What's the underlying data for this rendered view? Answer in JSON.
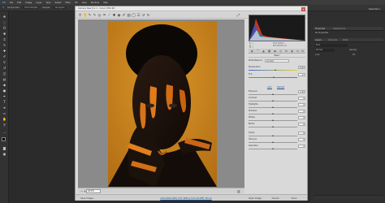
{
  "menubar": [
    "PS",
    "File",
    "Edit",
    "Image",
    "Layer",
    "Type",
    "Select",
    "Filter",
    "3D",
    "View",
    "Window",
    "Help"
  ],
  "options_bar": {
    "label": "Sample Size:",
    "value": "Point Sample",
    "sample_label": "Sample:",
    "sample_value": "All Layers"
  },
  "dialog": {
    "title": "Camera Raw 9.1.1  -  Canon EOS 6D",
    "preview_zoom": "26.8%",
    "bottom": {
      "save_image": "Save Image...",
      "workflow_link": "Adobe RGB (1998); 8 bit; 3648 by 5472 (20.0MP); 300 ppi",
      "open_image": "Open Image",
      "cancel": "Cancel",
      "done": "Done"
    },
    "histogram_values": {
      "r": "R: ---",
      "g": "G: ---",
      "b": "B: ---",
      "f": "f/2.8  1/200 s",
      "iso": "ISO 200  85 mm"
    },
    "panel_title": "Basic",
    "white_balance_label": "White Balance:",
    "white_balance_value": "As Shot",
    "auto_link": "Auto",
    "default_link": "Default",
    "sliders": [
      {
        "label": "Temperature",
        "value": "5200",
        "pos": 0.55
      },
      {
        "label": "Tint",
        "value": "+7",
        "pos": 0.52
      },
      {
        "label": "Exposure",
        "value": "0.00",
        "pos": 0.5
      },
      {
        "label": "Contrast",
        "value": "0",
        "pos": 0.5
      },
      {
        "label": "Highlights",
        "value": "0",
        "pos": 0.5
      },
      {
        "label": "Shadows",
        "value": "0",
        "pos": 0.5
      },
      {
        "label": "Whites",
        "value": "0",
        "pos": 0.5
      },
      {
        "label": "Blacks",
        "value": "0",
        "pos": 0.5
      },
      {
        "label": "Clarity",
        "value": "0",
        "pos": 0.5
      },
      {
        "label": "Vibrance",
        "value": "0",
        "pos": 0.5
      },
      {
        "label": "Saturation",
        "value": "0",
        "pos": 0.5
      }
    ]
  },
  "ps_panels": {
    "properties_tabs": [
      "Properties",
      "Adjustments"
    ],
    "properties_title": "No Properties",
    "layers_tabs": [
      "Layers",
      "Channels",
      "Paths"
    ],
    "kind_label": "Kind",
    "normal_label": "Normal",
    "opacity_label": "Opacity:",
    "lock_label": "Lock:",
    "fill_label": "Fill:"
  }
}
